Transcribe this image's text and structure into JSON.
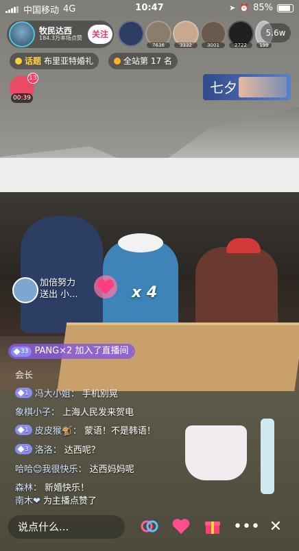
{
  "status": {
    "carrier": "中国移动",
    "network": "4G",
    "time": "10:47",
    "battery": "85%"
  },
  "host": {
    "name": "牧民达西",
    "likes": "184.3万本场点赞",
    "follow": "关注"
  },
  "viewers": [
    {
      "count": ""
    },
    {
      "count": "7636"
    },
    {
      "count": "3332"
    },
    {
      "count": "3001"
    },
    {
      "count": "2722"
    },
    {
      "count": "199"
    }
  ],
  "online": "5.6w",
  "topic": {
    "tag": "话题",
    "text": "布里亚特婚礼"
  },
  "rank": "全站第 17 名",
  "redpack": {
    "badge": "13",
    "timer": "00:39"
  },
  "banner": {
    "calli": "七夕"
  },
  "gift": {
    "line1": "加倍努力",
    "line2": "送出 小...",
    "combo": "x 4"
  },
  "join": {
    "level": "33",
    "text": "PANG×2 加入了直播间"
  },
  "chat_title": "会长",
  "chats": [
    {
      "level": "1",
      "user": "冯大小姐：",
      "msg": "手机别晃"
    },
    {
      "level": "",
      "user": "象棋小子：",
      "msg": "上海人民发来贺电"
    },
    {
      "level": "1",
      "user": "皮皮猴🐒：",
      "msg": "蒙语！不是韩语！"
    },
    {
      "level": "3",
      "user": "洛洛：",
      "msg": "达西呢？"
    },
    {
      "level": "",
      "user": "哈哈😊我很快乐：",
      "msg": "达西妈妈呢"
    },
    {
      "level": "",
      "user": "森林：",
      "msg": "新婚快乐！"
    },
    {
      "level": "",
      "user": "南木❤",
      "msg": "为主播点赞了"
    }
  ],
  "bottom": {
    "placeholder": "说点什么..."
  }
}
